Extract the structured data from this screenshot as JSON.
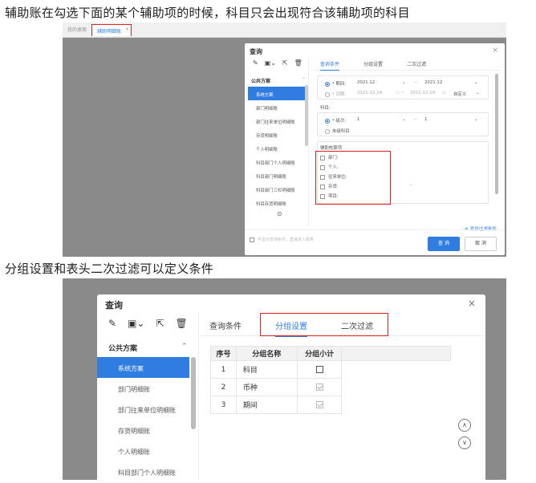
{
  "captions": {
    "first": "辅助账在勾选下面的某个辅助项的时候，科目只会出现符合该辅助项的科目",
    "second": "分组设置和表头二次过滤可以定义条件"
  },
  "shot1": {
    "tabs": {
      "home": "我的桌面",
      "active": "辅助明细账",
      "close": "×"
    },
    "dialog": {
      "title": "查询",
      "close": "×",
      "tool_icons": [
        "edit-icon",
        "save-icon",
        "export-icon",
        "delete-icon"
      ],
      "section": "公共方案",
      "schemes": [
        "系统方案",
        "部门明细账",
        "部门往来单位明细账",
        "存货明细账",
        "个人明细账",
        "科目部门个人明细账",
        "科目部门明细账",
        "科目部门三栏明细账",
        "科目存货明细账"
      ],
      "tabs": [
        "查询条件",
        "分组设置",
        "二次过滤"
      ],
      "period_label": "* 期间:",
      "period_from": "2021.12",
      "period_to": "2021.12",
      "date_label": "* 日期:",
      "date_from": "2021-12-24",
      "date_to": "2021-12-24",
      "date_mode": "自定义",
      "subject_label": "科目:",
      "level_label": "* 级次:",
      "level_from": "1",
      "level_to": "1",
      "leaf_label": "末级科目",
      "aux_title": "辅助核算项",
      "aux_items": [
        "部门:",
        "个人:",
        "往来单位:",
        "存货:",
        "项目:"
      ],
      "dash": "-",
      "add_filter": "添加过滤条件",
      "footer_note": "不显示查询条件，直接进入报表",
      "query_button": "查 询",
      "cancel_button": "取 消"
    }
  },
  "shot2": {
    "dialog": {
      "title": "查询",
      "close": "×",
      "section": "公共方案",
      "schemes": [
        "系统方案",
        "部门明细账",
        "部门往来单位明细账",
        "存货明细账",
        "个人明细账",
        "科目部门个人明细账"
      ],
      "tabs": [
        "查询条件",
        "分组设置",
        "二次过滤"
      ],
      "table_headers": [
        "序号",
        "分组名称",
        "分组小计"
      ],
      "rows": [
        {
          "no": "1",
          "name": "科目",
          "subtotal": false
        },
        {
          "no": "2",
          "name": "币种",
          "subtotal": true
        },
        {
          "no": "3",
          "name": "期间",
          "subtotal": true
        }
      ]
    }
  },
  "colors": {
    "accent": "#2f7de1",
    "highlight": "#e02020",
    "overlay": "#8a8a8a"
  }
}
